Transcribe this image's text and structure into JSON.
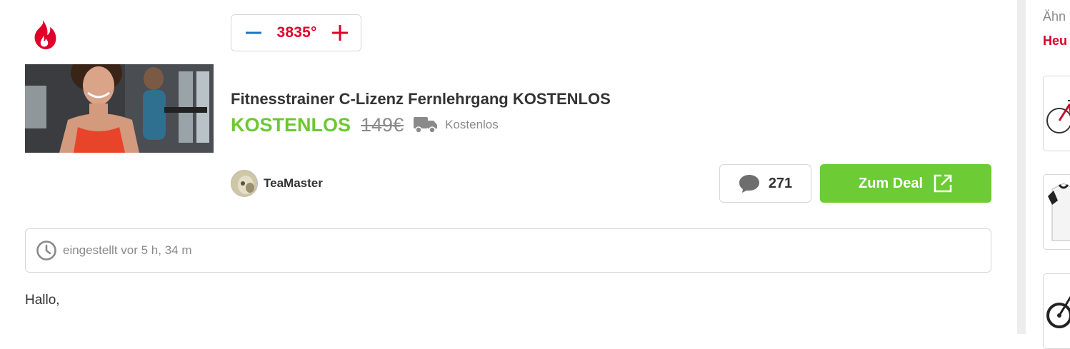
{
  "vote": {
    "temperature": "3835°"
  },
  "deal": {
    "title": "Fitnesstrainer C-Lizenz Fernlehrgang KOSTENLOS",
    "price": "KOSTENLOS",
    "old_price": "149€",
    "shipping": "Kostenlos"
  },
  "user": {
    "name": "TeaMaster"
  },
  "comments": {
    "count": "271"
  },
  "cta": {
    "label": "Zum Deal"
  },
  "meta": {
    "posted": "eingestellt vor 5 h, 34 m"
  },
  "body": {
    "text": "Hallo,"
  },
  "sidebar": {
    "heading": "Ähn",
    "link": "Heu",
    "thumbnails": [
      "bike-thumbnail",
      "shirt-thumbnail",
      "bike-thumbnail"
    ]
  },
  "colors": {
    "hot": "#e0002a",
    "price_green": "#6dc734",
    "cta_green": "#6dcb35",
    "minus_blue": "#1a73c9"
  }
}
